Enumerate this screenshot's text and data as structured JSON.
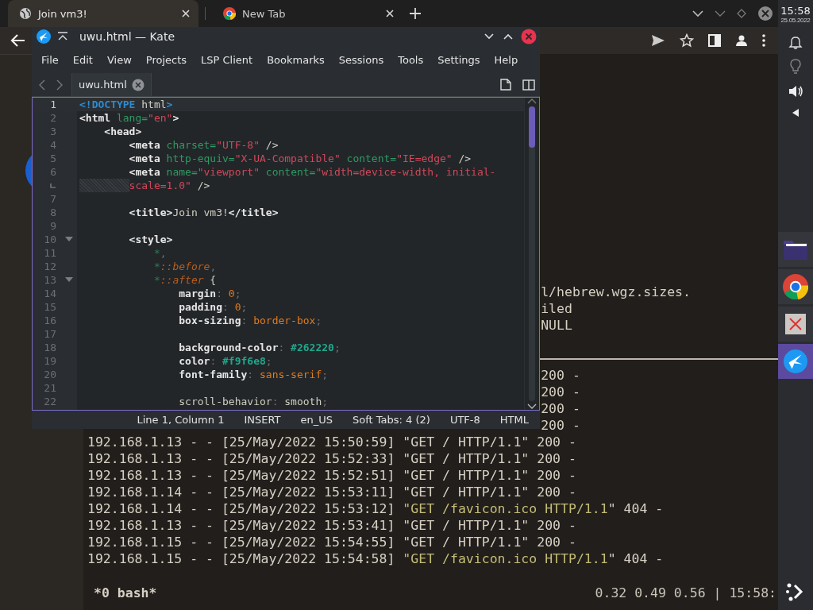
{
  "browser": {
    "tabs": [
      {
        "title": "Join vm3!",
        "selected": true
      },
      {
        "title": "New Tab",
        "selected": false
      }
    ]
  },
  "kate": {
    "title": "uwu.html — Kate",
    "menu": [
      "File",
      "Edit",
      "View",
      "Projects",
      "LSP Client",
      "Bookmarks",
      "Sessions",
      "Tools",
      "Settings",
      "Help"
    ],
    "doc_tabs": [
      {
        "label": "uwu.html",
        "selected": true
      }
    ],
    "lines": [
      {
        "number": "1",
        "current": true,
        "tokens": [
          {
            "kind": "kw",
            "text": "<!DOCTYPE"
          },
          {
            "kind": "text",
            "text": " html"
          },
          {
            "kind": "kw",
            "text": ">"
          }
        ]
      },
      {
        "number": "2",
        "tokens": [
          {
            "kind": "tag",
            "text": "<html"
          },
          {
            "kind": "attr",
            "text": " lang="
          },
          {
            "kind": "str",
            "text": "\"en\""
          },
          {
            "kind": "tag",
            "text": ">"
          }
        ]
      },
      {
        "number": "3",
        "tokens": [
          {
            "kind": "tag",
            "text": "    <head>"
          }
        ]
      },
      {
        "number": "4",
        "tokens": [
          {
            "kind": "tag",
            "text": "        <meta"
          },
          {
            "kind": "attr",
            "text": " charset="
          },
          {
            "kind": "str",
            "text": "\"UTF-8\""
          },
          {
            "kind": "text",
            "text": " />"
          }
        ]
      },
      {
        "number": "5",
        "tokens": [
          {
            "kind": "tag",
            "text": "        <meta"
          },
          {
            "kind": "attr",
            "text": " http-equiv="
          },
          {
            "kind": "str",
            "text": "\"X-UA-Compatible\""
          },
          {
            "kind": "attr",
            "text": " content="
          },
          {
            "kind": "str",
            "text": "\"IE=edge\""
          },
          {
            "kind": "text",
            "text": " />"
          }
        ]
      },
      {
        "number": "6",
        "tokens": [
          {
            "kind": "tag",
            "text": "        <meta"
          },
          {
            "kind": "attr",
            "text": " name="
          },
          {
            "kind": "str",
            "text": "\"viewport\""
          },
          {
            "kind": "attr",
            "text": " content="
          },
          {
            "kind": "str",
            "text": "\"width=device-width, initial-"
          }
        ]
      },
      {
        "wrap": true,
        "tokens": [
          {
            "kind": "str",
            "text": "scale=1.0\""
          },
          {
            "kind": "text",
            "text": " />"
          }
        ]
      },
      {
        "number": "7"
      },
      {
        "number": "8",
        "tokens": [
          {
            "kind": "tag",
            "text": "        <title>"
          },
          {
            "kind": "text",
            "text": "Join vm3!"
          },
          {
            "kind": "tag",
            "text": "</title>"
          }
        ]
      },
      {
        "number": "9"
      },
      {
        "number": "10",
        "fold": true,
        "tokens": [
          {
            "kind": "tag",
            "text": "        <style>"
          }
        ]
      },
      {
        "number": "11",
        "tokens": [
          {
            "kind": "sel",
            "text": "            *"
          },
          {
            "kind": "punct",
            "text": ","
          }
        ]
      },
      {
        "number": "12",
        "tokens": [
          {
            "kind": "sel",
            "text": "            *"
          },
          {
            "kind": "pseudo",
            "text": "::before"
          },
          {
            "kind": "punct",
            "text": ","
          }
        ]
      },
      {
        "number": "13",
        "fold": true,
        "tokens": [
          {
            "kind": "sel",
            "text": "            *"
          },
          {
            "kind": "pseudo",
            "text": "::after"
          },
          {
            "kind": "text",
            "text": " {"
          }
        ]
      },
      {
        "number": "14",
        "tokens": [
          {
            "kind": "prop",
            "text": "                margin"
          },
          {
            "kind": "punct",
            "text": ":"
          },
          {
            "kind": "value",
            "text": " 0"
          },
          {
            "kind": "punct",
            "text": ";"
          }
        ]
      },
      {
        "number": "15",
        "tokens": [
          {
            "kind": "prop",
            "text": "                padding"
          },
          {
            "kind": "punct",
            "text": ":"
          },
          {
            "kind": "value",
            "text": " 0"
          },
          {
            "kind": "punct",
            "text": ";"
          }
        ]
      },
      {
        "number": "16",
        "tokens": [
          {
            "kind": "prop",
            "text": "                box-sizing"
          },
          {
            "kind": "punct",
            "text": ":"
          },
          {
            "kind": "value",
            "text": " border-box"
          },
          {
            "kind": "punct",
            "text": ";"
          }
        ]
      },
      {
        "number": "17"
      },
      {
        "number": "18",
        "tokens": [
          {
            "kind": "prop",
            "text": "                background-color"
          },
          {
            "kind": "punct",
            "text": ":"
          },
          {
            "kind": "color",
            "text": " #262220"
          },
          {
            "kind": "punct",
            "text": ";"
          }
        ]
      },
      {
        "number": "19",
        "tokens": [
          {
            "kind": "prop",
            "text": "                color"
          },
          {
            "kind": "punct",
            "text": ":"
          },
          {
            "kind": "color",
            "text": " #f9f6e8"
          },
          {
            "kind": "punct",
            "text": ";"
          }
        ]
      },
      {
        "number": "20",
        "tokens": [
          {
            "kind": "prop",
            "text": "                font-family"
          },
          {
            "kind": "punct",
            "text": ":"
          },
          {
            "kind": "value",
            "text": " sans-serif"
          },
          {
            "kind": "punct",
            "text": ";"
          }
        ]
      },
      {
        "number": "21"
      },
      {
        "number": "22",
        "tokens": [
          {
            "kind": "prop2",
            "text": "                scroll-behavior"
          },
          {
            "kind": "punct",
            "text": ":"
          },
          {
            "kind": "text",
            "text": " smooth"
          },
          {
            "kind": "punct",
            "text": ";"
          }
        ]
      }
    ],
    "status": [
      "Line 1, Column 1",
      "INSERT",
      "en_US",
      "Soft Tabs: 4 (2)",
      "UTF-8",
      "HTML"
    ]
  },
  "terminal": {
    "upper_lines": [
      {
        "kind": "clipped",
        "segments": [
          {
            "kind": "plain",
            "text": "l/hebrew.wgz.sizes."
          }
        ]
      },
      {
        "kind": "clipped",
        "segments": [
          {
            "kind": "plain",
            "text": "iled"
          }
        ]
      },
      {
        "kind": "clipped",
        "segments": [
          {
            "kind": "plain",
            "text": "NULL"
          }
        ]
      }
    ],
    "log_lines": [
      {
        "kind": "clipped",
        "segments": [
          {
            "kind": "plain",
            "text": "200 -"
          }
        ]
      },
      {
        "kind": "clipped",
        "segments": [
          {
            "kind": "plain",
            "text": "200 -"
          }
        ]
      },
      {
        "kind": "clipped",
        "segments": [
          {
            "kind": "plain",
            "text": "200 -"
          }
        ]
      },
      {
        "kind": "clipped",
        "segments": [
          {
            "kind": "plain",
            "text": "200 -"
          }
        ]
      },
      {
        "kind": "full",
        "segments": [
          {
            "kind": "plain",
            "text": "192.168.1.13 - - [25/May/2022 15:50:59] \"GET / HTTP/1.1\" 200 -"
          }
        ]
      },
      {
        "kind": "full",
        "segments": [
          {
            "kind": "plain",
            "text": "192.168.1.13 - - [25/May/2022 15:52:33] \"GET / HTTP/1.1\" 200 -"
          }
        ]
      },
      {
        "kind": "full",
        "segments": [
          {
            "kind": "plain",
            "text": "192.168.1.13 - - [25/May/2022 15:52:51] \"GET / HTTP/1.1\" 200 -"
          }
        ]
      },
      {
        "kind": "full",
        "segments": [
          {
            "kind": "plain",
            "text": "192.168.1.14 - - [25/May/2022 15:53:11] \"GET / HTTP/1.1\" 200 -"
          }
        ]
      },
      {
        "kind": "full",
        "segments": [
          {
            "kind": "plain",
            "text": "192.168.1.14 - - [25/May/2022 15:53:12] "
          },
          {
            "kind": "warn",
            "text": "\"GET /favicon.ico HTTP/1.1"
          },
          {
            "kind": "plain",
            "text": "\" 404 -"
          }
        ]
      },
      {
        "kind": "full",
        "segments": [
          {
            "kind": "plain",
            "text": "192.168.1.13 - - [25/May/2022 15:53:41] \"GET / HTTP/1.1\" 200 -"
          }
        ]
      },
      {
        "kind": "full",
        "segments": [
          {
            "kind": "plain",
            "text": "192.168.1.15 - - [25/May/2022 15:54:55] \"GET / HTTP/1.1\" 200 -"
          }
        ]
      },
      {
        "kind": "full",
        "segments": [
          {
            "kind": "plain",
            "text": "192.168.1.15 - - [25/May/2022 15:54:58] "
          },
          {
            "kind": "warn",
            "text": "\"GET /favicon.ico HTTP/1.1"
          },
          {
            "kind": "plain",
            "text": "\" 404 -"
          }
        ]
      }
    ],
    "window_name": "*0 bash*",
    "status_right": "0.32 0.49 0.56 | 15:58:"
  },
  "panel": {
    "time": "15:58",
    "date": "25.05.2022",
    "dock": [
      {
        "kind": "folder",
        "selected": false
      },
      {
        "kind": "chrome",
        "selected": false
      },
      {
        "kind": "error",
        "selected": false
      },
      {
        "kind": "kate",
        "selected": true
      }
    ]
  }
}
